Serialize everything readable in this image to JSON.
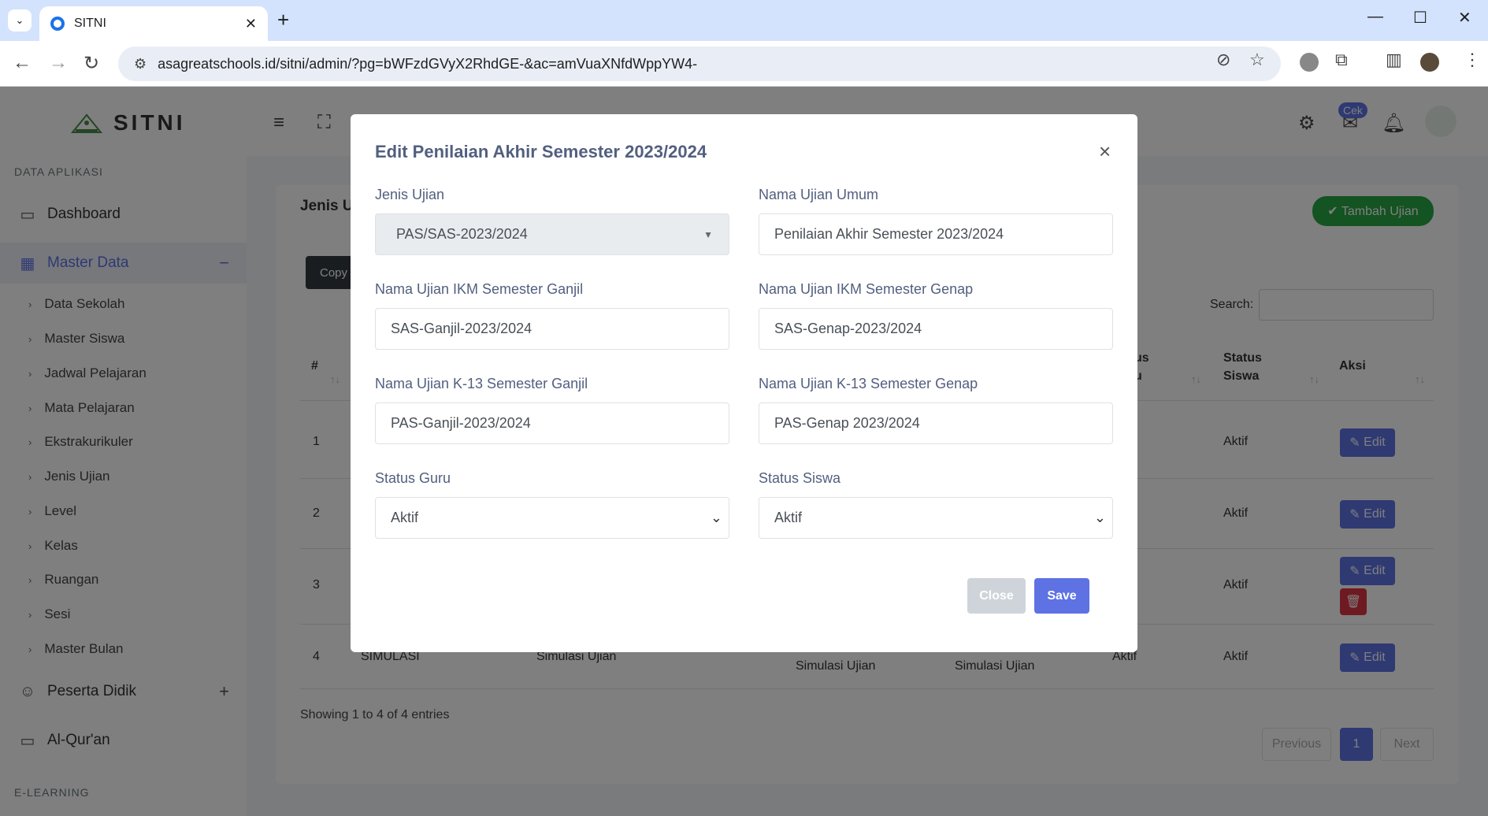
{
  "browser": {
    "tab_title": "SITNI",
    "url": "asagreatschools.id/sitni/admin/?pg=bWFzdGVyX2RhdGE-&ac=amVuaXNfdWppYW4-"
  },
  "app": {
    "brand": "SITNI",
    "notif_badge": "Cek"
  },
  "sidebar": {
    "section1": "DATA APLIKASI",
    "dashboard": "Dashboard",
    "master_data": "Master Data",
    "master_toggle": "−",
    "sub_items": [
      "Data Sekolah",
      "Master Siswa",
      "Jadwal Pelajaran",
      "Mata Pelajaran",
      "Ekstrakurikuler",
      "Jenis Ujian",
      "Level",
      "Kelas",
      "Ruangan",
      "Sesi",
      "Master Bulan"
    ],
    "peserta_didik": "Peserta Didik",
    "peserta_toggle": "+",
    "alquran": "Al-Qur'an",
    "section2": "E-LEARNING"
  },
  "page": {
    "card_title": "Jenis U",
    "add_button": "✔ Tambah Ujian",
    "copy_button": "Copy",
    "search_label": "Search:",
    "headers": {
      "num": "#",
      "status_partial_1": "us",
      "status_partial_2": "u",
      "status_siswa_1": "Status",
      "status_siswa_2": "Siswa",
      "aksi": "Aksi"
    },
    "rows": [
      {
        "num": "1",
        "status_siswa": "Aktif"
      },
      {
        "num": "2",
        "status_siswa": "Aktif"
      },
      {
        "num": "3",
        "status_siswa": "Aktif"
      },
      {
        "num": "4",
        "kode": "SIMULASI",
        "nama": "Simulasi Ujian",
        "c1": "Simulasi Ujian",
        "c2": "Simulasi Ujian",
        "status_guru": "Aktif",
        "status_siswa": "Aktif"
      }
    ],
    "edit_label": "Edit",
    "showing": "Showing 1 to 4 of 4 entries",
    "pager_prev": "Previous",
    "pager_current": "1",
    "pager_next": "Next"
  },
  "modal": {
    "title": "Edit Penilaian Akhir Semester 2023/2024",
    "jenis_ujian_label": "Jenis Ujian",
    "jenis_ujian_value": "PAS/SAS-2023/2024",
    "nama_umum_label": "Nama Ujian Umum",
    "nama_umum_value": "Penilaian Akhir Semester 2023/2024",
    "ikm_ganjil_label": "Nama Ujian IKM Semester Ganjil",
    "ikm_ganjil_value": "SAS-Ganjil-2023/2024",
    "ikm_genap_label": "Nama Ujian IKM Semester Genap",
    "ikm_genap_value": "SAS-Genap-2023/2024",
    "k13_ganjil_label": "Nama Ujian K-13 Semester Ganjil",
    "k13_ganjil_value": "PAS-Ganjil-2023/2024",
    "k13_genap_label": "Nama Ujian K-13 Semester Genap",
    "k13_genap_value": "PAS-Genap 2023/2024",
    "status_guru_label": "Status Guru",
    "status_guru_value": "Aktif",
    "status_siswa_label": "Status Siswa",
    "status_siswa_value": "Aktif",
    "close_button": "Close",
    "save_button": "Save"
  },
  "colors": {
    "primary": "#5e72e4",
    "success": "#28a745",
    "danger": "#dc3545"
  },
  "icons": [
    "tab-list-icon",
    "globe-icon",
    "close-icon",
    "plus-icon",
    "back-icon",
    "forward-icon",
    "reload-icon",
    "site-info-icon",
    "eye-off-icon",
    "star-icon",
    "extension-icon",
    "puzzle-icon",
    "sidepanel-icon",
    "profile-icon",
    "menu-icon",
    "hamburger-icon",
    "fullscreen-icon",
    "chip-icon",
    "inbox-icon",
    "bell-icon",
    "monitor-icon",
    "grid-icon",
    "users-icon",
    "cast-icon",
    "edit-icon",
    "trash-icon"
  ]
}
